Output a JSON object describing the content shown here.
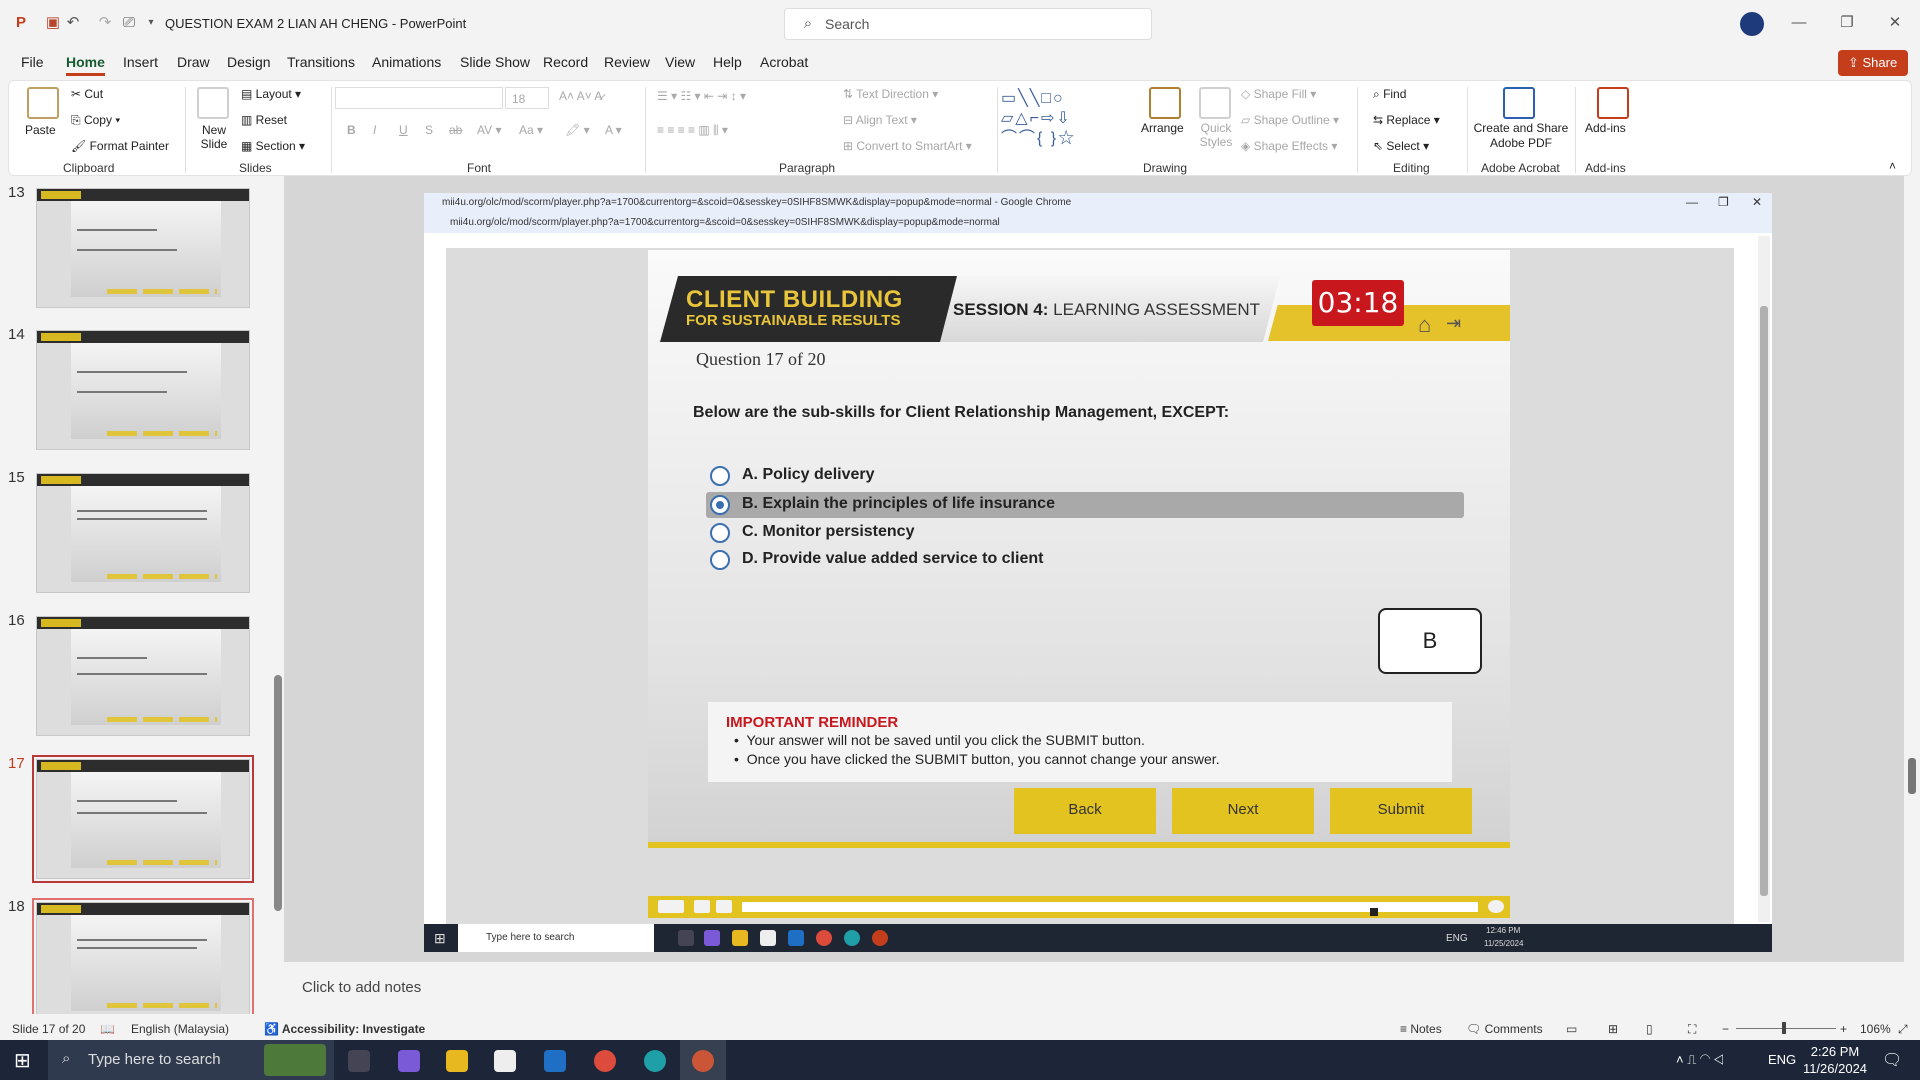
{
  "titlebar": {
    "doc_title": "QUESTION EXAM 2 LIAN AH CHENG  -  PowerPoint",
    "search_placeholder": "Search"
  },
  "menu": [
    "File",
    "Home",
    "Insert",
    "Draw",
    "Design",
    "Transitions",
    "Animations",
    "Slide Show",
    "Record",
    "Review",
    "View",
    "Help",
    "Acrobat"
  ],
  "share_label": "Share",
  "ribbon": {
    "clipboard": {
      "paste": "Paste",
      "cut": "Cut",
      "copy": "Copy",
      "format_painter": "Format Painter",
      "label": "Clipboard"
    },
    "slides": {
      "new_slide": "New Slide",
      "layout": "Layout",
      "reset": "Reset",
      "section": "Section",
      "label": "Slides"
    },
    "font": {
      "font_size": "18",
      "label": "Font"
    },
    "paragraph": {
      "text_direction": "Text Direction",
      "align_text": "Align Text",
      "convert": "Convert to SmartArt",
      "label": "Paragraph"
    },
    "drawing": {
      "arrange": "Arrange",
      "quick_styles": "Quick Styles",
      "shape_fill": "Shape Fill",
      "shape_outline": "Shape Outline",
      "shape_effects": "Shape Effects",
      "label": "Drawing"
    },
    "editing": {
      "find": "Find",
      "replace": "Replace",
      "select": "Select",
      "label": "Editing"
    },
    "acrobat": {
      "create": "Create and Share Adobe PDF",
      "label": "Adobe Acrobat"
    },
    "addins": {
      "addins": "Add-ins",
      "label": "Add-ins"
    }
  },
  "thumbnails": [
    "13",
    "14",
    "15",
    "16",
    "17",
    "18"
  ],
  "selected_slide": "17",
  "browser": {
    "window_title": "mii4u.org/olc/mod/scorm/player.php?a=1700&currentorg=&scoid=0&sesskey=0SIHF8SMWK&display=popup&mode=normal - Google Chrome",
    "url": "mii4u.org/olc/mod/scorm/player.php?a=1700&currentorg=&scoid=0&sesskey=0SIHF8SMWK&display=popup&mode=normal"
  },
  "quiz": {
    "brand_line1": "CLIENT BUILDING",
    "brand_line2": "FOR SUSTAINABLE RESULTS",
    "session_bold": "SESSION 4:",
    "session_rest": " LEARNING ASSESSMENT",
    "timer": "03:18",
    "question_number": "Question 17 of 20",
    "question": "Below are the sub-skills for Client Relationship Management, EXCEPT:",
    "options": [
      "A. Policy delivery",
      "B. Explain the principles of life insurance",
      "C. Monitor persistency",
      "D. Provide value added service to client"
    ],
    "selected_option": "B",
    "answer_box": "B",
    "reminder_title": "IMPORTANT REMINDER",
    "reminder_1": "Your answer will not be saved until you click the SUBMIT button.",
    "reminder_2": "Once you have clicked the SUBMIT button, you cannot change your answer.",
    "back": "Back",
    "next": "Next",
    "submit": "Submit"
  },
  "inner_taskbar": {
    "search": "Type here to search",
    "lang": "ENG",
    "time": "12:46 PM",
    "date": "11/25/2024"
  },
  "notes_placeholder": "Click to add notes",
  "status": {
    "slide": "Slide 17 of 20",
    "language": "English (Malaysia)",
    "accessibility": "Accessibility: Investigate",
    "notes": "Notes",
    "comments": "Comments",
    "zoom": "106%"
  },
  "taskbar": {
    "search": "Type here to search",
    "lang": "ENG",
    "time": "2:26 PM",
    "date": "11/26/2024"
  }
}
